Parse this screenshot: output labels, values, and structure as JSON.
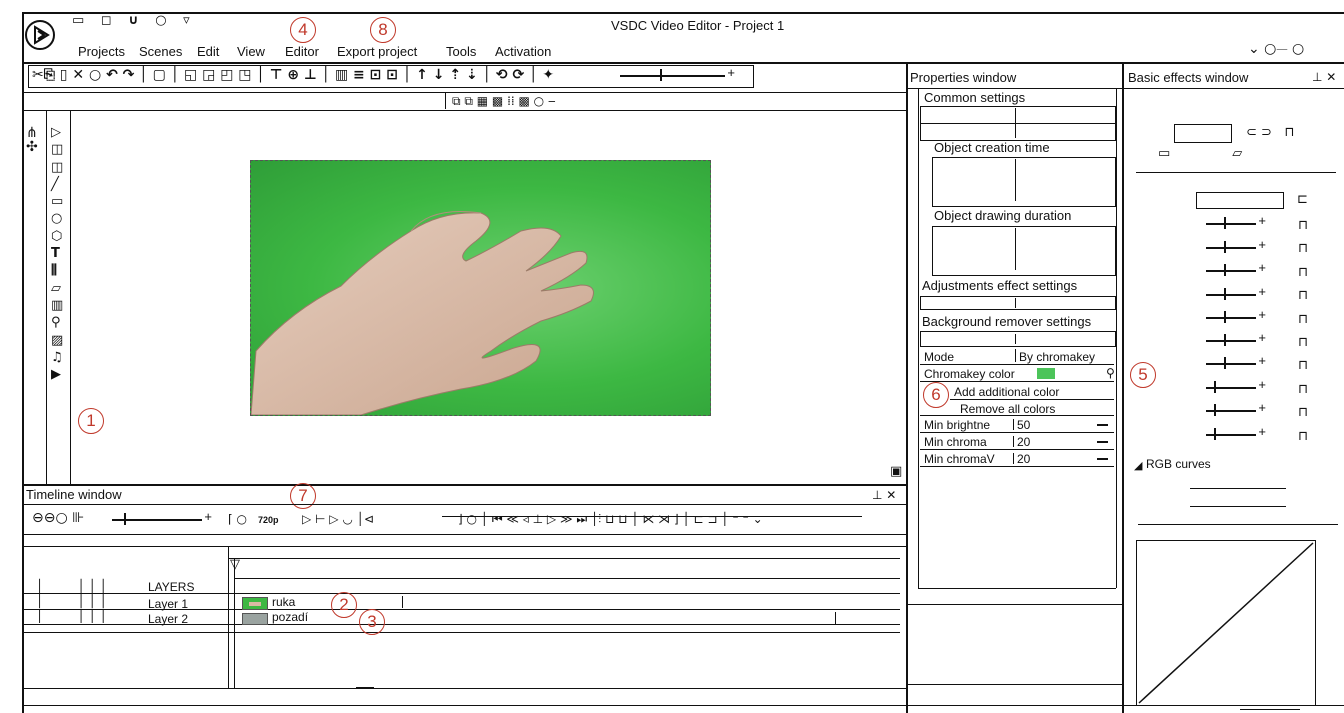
{
  "app": {
    "title": "VSDC Video Editor - Project 1",
    "logo_icon": "play-logo-icon"
  },
  "menu": {
    "items": [
      "Projects",
      "Scenes",
      "Edit",
      "View",
      "Editor",
      "Export project",
      "Tools",
      "Activation"
    ]
  },
  "annotations": [
    "1",
    "2",
    "3",
    "4",
    "5",
    "6",
    "7",
    "8"
  ],
  "properties": {
    "title": "Properties window",
    "common_settings": "Common settings",
    "object_creation_time": "Object creation time",
    "object_drawing_duration": "Object drawing duration",
    "adjustments": "Adjustments effect settings",
    "background_remover": "Background remover settings",
    "mode_label": "Mode",
    "mode_value": "By chromakey",
    "chromakey_label": "Chromakey color",
    "chromakey_color": "#4cc45a",
    "add_color": "Add additional color",
    "remove_colors": "Remove all colors",
    "min_brightness_label": "Min brightne",
    "min_brightness_value": "50",
    "min_chroma_label": "Min chroma",
    "min_chroma_value": "20",
    "min_chromav_label": "Min chromaV",
    "min_chromav_value": "20"
  },
  "effects": {
    "title": "Basic effects window",
    "rgb_curves": "RGB curves"
  },
  "timeline": {
    "title": "Timeline window",
    "resolution": "720p",
    "layers_header": "LAYERS",
    "rows": [
      {
        "layer": "Layer 1",
        "clip": "ruka"
      },
      {
        "layer": "Layer 2",
        "clip": "pozadí"
      }
    ]
  },
  "colors": {
    "badge": "#c0392b",
    "green_screen": "#3db843",
    "skin": "#d9b9a4"
  }
}
